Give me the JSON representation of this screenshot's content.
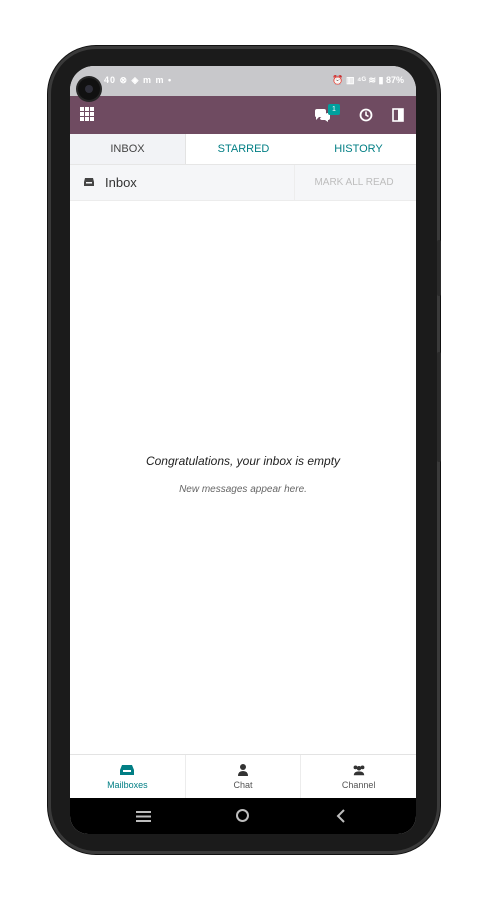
{
  "status_bar": {
    "left_text": "40 ⊗ ◈ m m •",
    "right_text": "⏰ ▥ ⁴ᴳ ≋ ▮ 87%"
  },
  "header": {
    "chat_badge": "1"
  },
  "tabs": [
    {
      "label": "INBOX",
      "active": true
    },
    {
      "label": "STARRED",
      "active": false
    },
    {
      "label": "HISTORY",
      "active": false
    }
  ],
  "mailbox": {
    "label": "Inbox",
    "mark_all_read": "MARK ALL READ"
  },
  "empty_state": {
    "title": "Congratulations, your inbox is empty",
    "subtitle": "New messages appear here."
  },
  "bottom_nav": [
    {
      "label": "Mailboxes",
      "icon": "inbox-icon",
      "active": true
    },
    {
      "label": "Chat",
      "icon": "user-icon",
      "active": false
    },
    {
      "label": "Channel",
      "icon": "users-icon",
      "active": false
    }
  ],
  "colors": {
    "app_bar": "#6f4b61",
    "accent": "#017e84",
    "badge": "#00a09d"
  }
}
